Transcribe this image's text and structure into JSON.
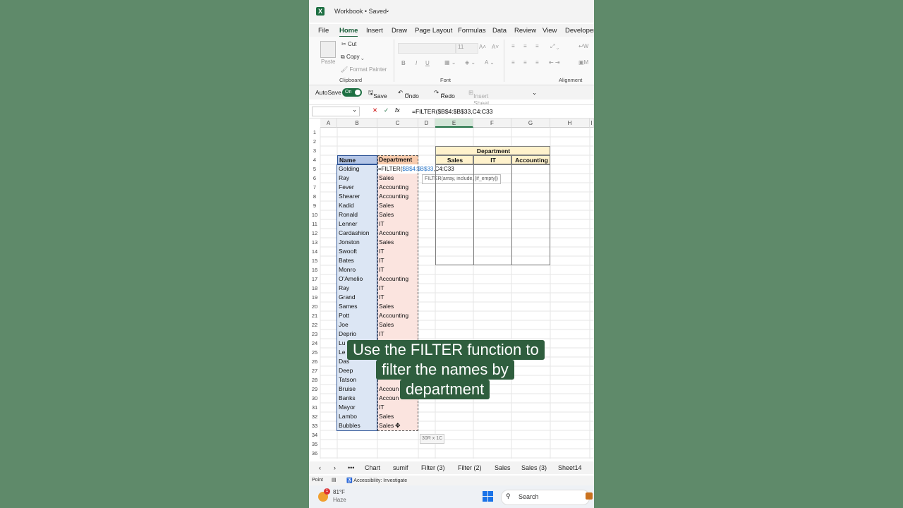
{
  "app": {
    "title": "Workbook • Saved",
    "logo": "X"
  },
  "menu": [
    "File",
    "Home",
    "Insert",
    "Draw",
    "Page Layout",
    "Formulas",
    "Data",
    "Review",
    "View",
    "Developer"
  ],
  "ribbon": {
    "paste": "Paste",
    "cut": "Cut",
    "copy": "Copy",
    "format_painter": "Format Painter",
    "clipboard": "Clipboard",
    "font": "Font",
    "alignment": "Alignment",
    "font_size": "11"
  },
  "qat": {
    "autosave": "AutoSave",
    "toggle": "On",
    "save": "Save",
    "undo": "Undo",
    "redo": "Redo",
    "insert_rows": "Insert Sheet Rows"
  },
  "formula_bar": {
    "formula": "=FILTER($B$4:$B$33,C4:C33",
    "fx": "fx"
  },
  "columns": [
    "A",
    "B",
    "C",
    "D",
    "E",
    "F",
    "G",
    "H",
    "I"
  ],
  "rows": [
    "1",
    "2",
    "3",
    "4",
    "5",
    "6",
    "7",
    "8",
    "9",
    "10",
    "11",
    "12",
    "13",
    "14",
    "15",
    "16",
    "17",
    "18",
    "19",
    "20",
    "21",
    "22",
    "23",
    "24",
    "25",
    "26",
    "27",
    "28",
    "29",
    "30",
    "31",
    "32",
    "33",
    "34",
    "35",
    "36"
  ],
  "table": {
    "name_header": "Name",
    "dept_header": "Department",
    "names": [
      "Golding",
      "Ray",
      "Fever",
      "Shearer",
      "Kadid",
      "Ronald",
      "Lenner",
      "Cardashion",
      "Jonston",
      "Swooft",
      "Bates",
      "Monro",
      "O'Amelio",
      "Ray",
      "Grand",
      "Sames",
      "Pott",
      "Joe",
      "Deprio",
      "Lu",
      "Le",
      "Das",
      "Deep",
      "Tatson",
      "Bruise",
      "Banks",
      "Mayor",
      "Lambo",
      "Bubbles"
    ],
    "depts": [
      "",
      "Sales",
      "Accounting",
      "Accounting",
      "Sales",
      "Sales",
      "IT",
      "Accounting",
      "Sales",
      "IT",
      "IT",
      "IT",
      "Accounting",
      "IT",
      "IT",
      "Sales",
      "Accounting",
      "Sales",
      "IT",
      "",
      "",
      "",
      "",
      "",
      "Accoun",
      "Accoun",
      "IT",
      "Sales",
      "Sales"
    ],
    "edit_prefix": "=FILTER(",
    "edit_ref1": "$B$4:$B$33",
    "edit_ref2": ",C4:C33"
  },
  "tooltip": {
    "text": "FILTER(array, include, [if_empty])",
    "size_hint": "30R x 1C"
  },
  "output": {
    "title": "Department",
    "headers": [
      "Sales",
      "IT",
      "Accounting"
    ]
  },
  "sheet_tabs": [
    "Chart",
    "sumif",
    "Filter (3)",
    "Filter (2)",
    "Sales",
    "Sales (3)",
    "Sheet14"
  ],
  "status": {
    "mode": "Point",
    "accessibility": "Accessibility: Investigate"
  },
  "taskbar": {
    "temp": "81°F",
    "weather": "Haze",
    "search": "Search",
    "badge": "1"
  },
  "caption": [
    "Use the FILTER function to",
    "filter the names by",
    "department"
  ]
}
